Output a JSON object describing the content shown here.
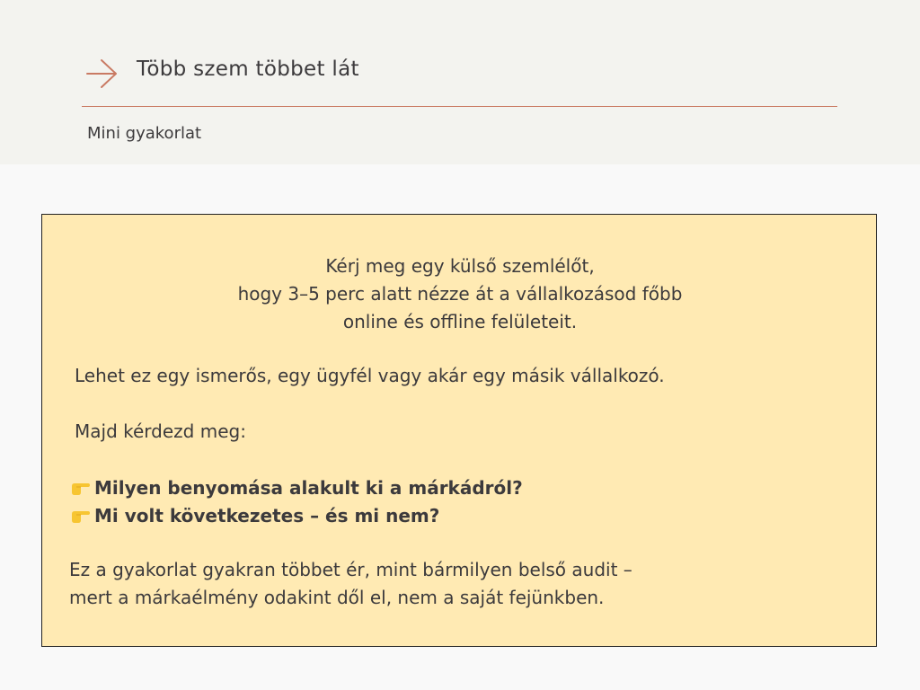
{
  "header": {
    "title": "Több szem többet lát",
    "subtitle": "Mini gyakorlat",
    "accent_color": "#c97a63",
    "icon": "arrow-right-icon"
  },
  "card": {
    "background": "#ffeab3",
    "intro_lines": [
      "Kérj meg egy külső szemlélőt,",
      "hogy 3–5 perc alatt nézze át a vállalkozásod főbb",
      "online és offline felületeit."
    ],
    "people_text": "Lehet ez egy ismerős, egy ügyfél vagy akár egy másik vállalkozó.",
    "ask_text": "Majd kérdezd meg:",
    "questions": [
      {
        "icon": "pointing-hand-icon",
        "text": "Milyen benyomása alakult ki a márkádról?"
      },
      {
        "icon": "pointing-hand-icon",
        "text": "Mi volt következetes – és mi nem?"
      }
    ],
    "closing_lines": [
      "Ez a gyakorlat gyakran többet ér, mint bármilyen belső audit –",
      "mert a márkaélmény odakint dől el, nem a saját fejünkben."
    ]
  }
}
